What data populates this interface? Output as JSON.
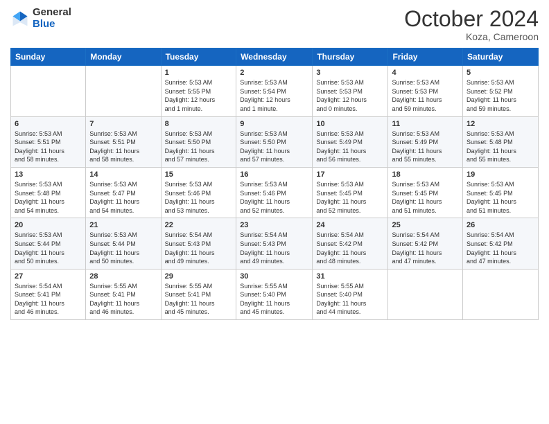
{
  "header": {
    "logo": {
      "general": "General",
      "blue": "Blue"
    },
    "title": "October 2024",
    "location": "Koza, Cameroon"
  },
  "calendar": {
    "days_of_week": [
      "Sunday",
      "Monday",
      "Tuesday",
      "Wednesday",
      "Thursday",
      "Friday",
      "Saturday"
    ],
    "weeks": [
      [
        {
          "day": "",
          "info": ""
        },
        {
          "day": "",
          "info": ""
        },
        {
          "day": "1",
          "info": "Sunrise: 5:53 AM\nSunset: 5:55 PM\nDaylight: 12 hours\nand 1 minute."
        },
        {
          "day": "2",
          "info": "Sunrise: 5:53 AM\nSunset: 5:54 PM\nDaylight: 12 hours\nand 1 minute."
        },
        {
          "day": "3",
          "info": "Sunrise: 5:53 AM\nSunset: 5:53 PM\nDaylight: 12 hours\nand 0 minutes."
        },
        {
          "day": "4",
          "info": "Sunrise: 5:53 AM\nSunset: 5:53 PM\nDaylight: 11 hours\nand 59 minutes."
        },
        {
          "day": "5",
          "info": "Sunrise: 5:53 AM\nSunset: 5:52 PM\nDaylight: 11 hours\nand 59 minutes."
        }
      ],
      [
        {
          "day": "6",
          "info": "Sunrise: 5:53 AM\nSunset: 5:51 PM\nDaylight: 11 hours\nand 58 minutes."
        },
        {
          "day": "7",
          "info": "Sunrise: 5:53 AM\nSunset: 5:51 PM\nDaylight: 11 hours\nand 58 minutes."
        },
        {
          "day": "8",
          "info": "Sunrise: 5:53 AM\nSunset: 5:50 PM\nDaylight: 11 hours\nand 57 minutes."
        },
        {
          "day": "9",
          "info": "Sunrise: 5:53 AM\nSunset: 5:50 PM\nDaylight: 11 hours\nand 57 minutes."
        },
        {
          "day": "10",
          "info": "Sunrise: 5:53 AM\nSunset: 5:49 PM\nDaylight: 11 hours\nand 56 minutes."
        },
        {
          "day": "11",
          "info": "Sunrise: 5:53 AM\nSunset: 5:49 PM\nDaylight: 11 hours\nand 55 minutes."
        },
        {
          "day": "12",
          "info": "Sunrise: 5:53 AM\nSunset: 5:48 PM\nDaylight: 11 hours\nand 55 minutes."
        }
      ],
      [
        {
          "day": "13",
          "info": "Sunrise: 5:53 AM\nSunset: 5:48 PM\nDaylight: 11 hours\nand 54 minutes."
        },
        {
          "day": "14",
          "info": "Sunrise: 5:53 AM\nSunset: 5:47 PM\nDaylight: 11 hours\nand 54 minutes."
        },
        {
          "day": "15",
          "info": "Sunrise: 5:53 AM\nSunset: 5:46 PM\nDaylight: 11 hours\nand 53 minutes."
        },
        {
          "day": "16",
          "info": "Sunrise: 5:53 AM\nSunset: 5:46 PM\nDaylight: 11 hours\nand 52 minutes."
        },
        {
          "day": "17",
          "info": "Sunrise: 5:53 AM\nSunset: 5:45 PM\nDaylight: 11 hours\nand 52 minutes."
        },
        {
          "day": "18",
          "info": "Sunrise: 5:53 AM\nSunset: 5:45 PM\nDaylight: 11 hours\nand 51 minutes."
        },
        {
          "day": "19",
          "info": "Sunrise: 5:53 AM\nSunset: 5:45 PM\nDaylight: 11 hours\nand 51 minutes."
        }
      ],
      [
        {
          "day": "20",
          "info": "Sunrise: 5:53 AM\nSunset: 5:44 PM\nDaylight: 11 hours\nand 50 minutes."
        },
        {
          "day": "21",
          "info": "Sunrise: 5:53 AM\nSunset: 5:44 PM\nDaylight: 11 hours\nand 50 minutes."
        },
        {
          "day": "22",
          "info": "Sunrise: 5:54 AM\nSunset: 5:43 PM\nDaylight: 11 hours\nand 49 minutes."
        },
        {
          "day": "23",
          "info": "Sunrise: 5:54 AM\nSunset: 5:43 PM\nDaylight: 11 hours\nand 49 minutes."
        },
        {
          "day": "24",
          "info": "Sunrise: 5:54 AM\nSunset: 5:42 PM\nDaylight: 11 hours\nand 48 minutes."
        },
        {
          "day": "25",
          "info": "Sunrise: 5:54 AM\nSunset: 5:42 PM\nDaylight: 11 hours\nand 47 minutes."
        },
        {
          "day": "26",
          "info": "Sunrise: 5:54 AM\nSunset: 5:42 PM\nDaylight: 11 hours\nand 47 minutes."
        }
      ],
      [
        {
          "day": "27",
          "info": "Sunrise: 5:54 AM\nSunset: 5:41 PM\nDaylight: 11 hours\nand 46 minutes."
        },
        {
          "day": "28",
          "info": "Sunrise: 5:55 AM\nSunset: 5:41 PM\nDaylight: 11 hours\nand 46 minutes."
        },
        {
          "day": "29",
          "info": "Sunrise: 5:55 AM\nSunset: 5:41 PM\nDaylight: 11 hours\nand 45 minutes."
        },
        {
          "day": "30",
          "info": "Sunrise: 5:55 AM\nSunset: 5:40 PM\nDaylight: 11 hours\nand 45 minutes."
        },
        {
          "day": "31",
          "info": "Sunrise: 5:55 AM\nSunset: 5:40 PM\nDaylight: 11 hours\nand 44 minutes."
        },
        {
          "day": "",
          "info": ""
        },
        {
          "day": "",
          "info": ""
        }
      ]
    ]
  }
}
